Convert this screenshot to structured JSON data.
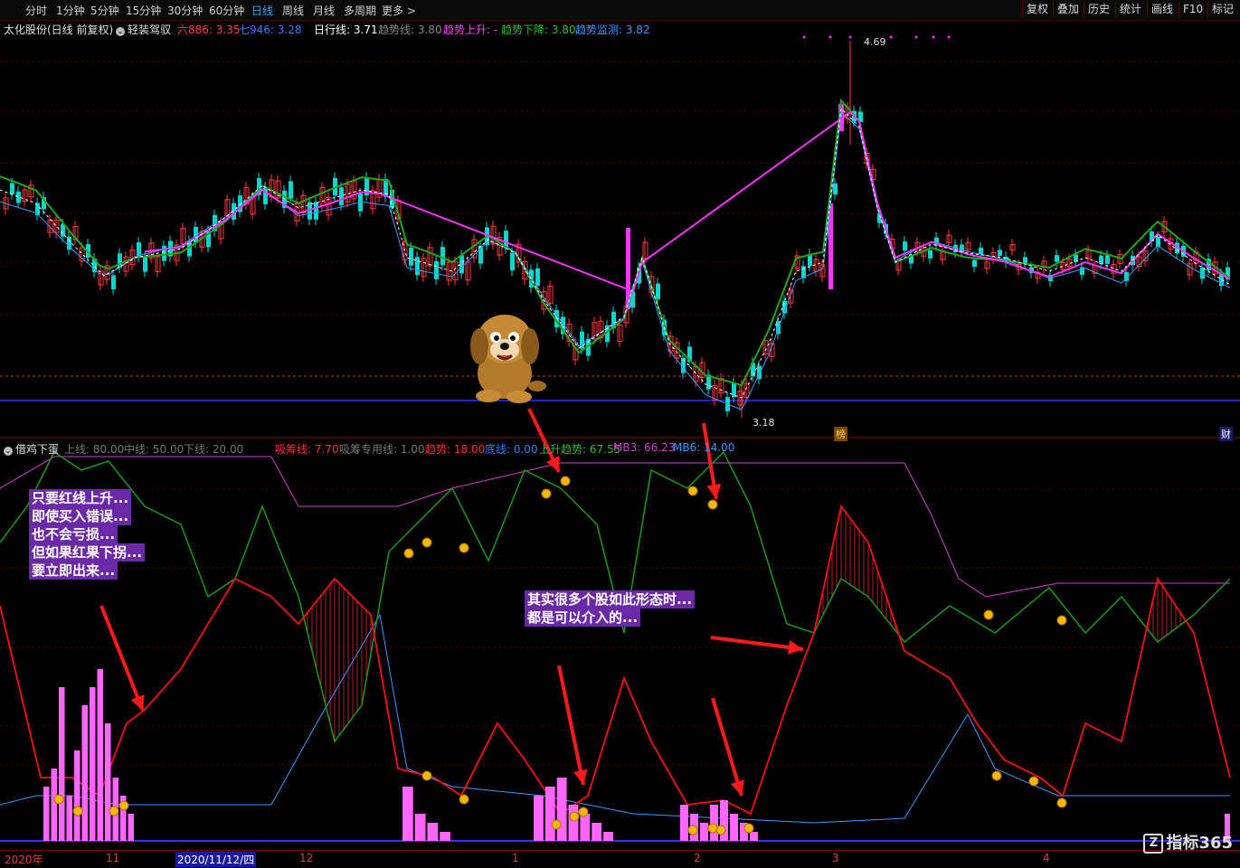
{
  "toolbar": {
    "tabs": [
      "分时",
      "1分钟",
      "5分钟",
      "15分钟",
      "30分钟",
      "60分钟",
      "日线",
      "周线",
      "月线",
      "多周期",
      "更多 >"
    ],
    "active_tab": "日线",
    "right_buttons": [
      "复权",
      "叠加",
      "历史",
      "统计",
      "画线",
      "F10",
      "标记"
    ]
  },
  "main_info": {
    "stock": "太化股份(日线 前复权)",
    "indicator": "轻装驾驭",
    "six_label": "六886: 3.35",
    "seven_label": "七946: 3.28",
    "rixian_label": "日行线: 3.71",
    "trend_label": "趋势线: 3.80",
    "up_label": "趋势上升: -",
    "down_label": "趋势下降: 3.80",
    "monitor_label": "趋势监测: 3.82",
    "high_value": "4.69",
    "low_value": "3.18",
    "marker_bang": "榜",
    "marker_cai": "财"
  },
  "sub_info": {
    "name": "借鸡下蛋",
    "upper": "上线: 80.00",
    "middle": "中线: 50.00",
    "lower": "下线: 20.00",
    "xichou": "吸筹线: 7.70",
    "xichou_special": "吸筹专用线: 1.00",
    "trend": "趋势: 18.00",
    "bottom": "底线: 0.00",
    "up_trend": "上升趋势: 67.55",
    "mb3": "MB3: 66.23",
    "mb6": "MB6: 14.00"
  },
  "notes": {
    "left": [
      "只要红线上升...",
      "即使买入错误...",
      "也不会亏损...",
      "但如果红果下拐...",
      "要立即出来..."
    ],
    "middle": [
      "其实很多个股如此形态时...",
      "都是可以介入的..."
    ]
  },
  "axis_dates": [
    "2020年",
    "11",
    "2020/11/12/四",
    "12",
    "1",
    "2",
    "3",
    "4"
  ],
  "brand": "指标365",
  "colors": {
    "up": "#ff3b3b",
    "down": "#00d8d0",
    "ma_white": "#ffffff",
    "ma_magenta": "#ff33ff",
    "ma_green": "#1fa81f",
    "ma_blue": "#3a9aff",
    "red_line": "#ff1010",
    "green_line": "#1a9a1a",
    "blue_line": "#3a9aff",
    "magenta_line": "#d040d0",
    "bars": "#ff66ff"
  }
}
